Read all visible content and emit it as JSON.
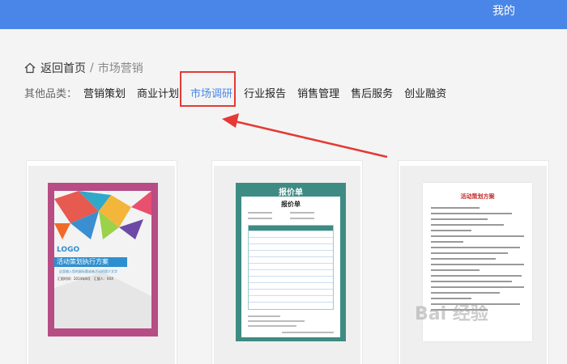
{
  "header": {
    "mine_label": "我的"
  },
  "breadcrumb": {
    "home_label": "返回首页",
    "separator": "/",
    "current": "市场营销"
  },
  "categories": {
    "label": "其他品类：",
    "items": [
      "营销策划",
      "商业计划",
      "市场调研",
      "行业报告",
      "销售管理",
      "售后服务",
      "创业融资"
    ],
    "active": "市场调研"
  },
  "cards": [
    {
      "logo_text": "LOGO",
      "banner_text": "活动策划执行方案",
      "subtitle": "这里输入您的副标题或者活动的简介文字",
      "info": "汇报时间：2014年8月　汇报人：XXX"
    },
    {
      "title": "报价单",
      "heading": "报价单"
    },
    {
      "title": "活动策划方案"
    }
  ],
  "watermark": "Bai 经验",
  "colors": {
    "accent": "#4a86e8",
    "highlight_box": "#e53935",
    "poster_frame": "#b64d84",
    "quote_frame": "#3e8b83"
  }
}
